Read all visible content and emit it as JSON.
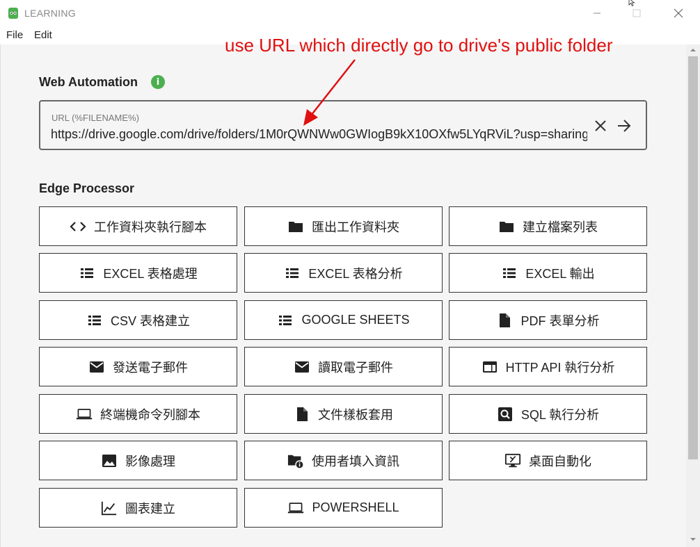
{
  "window": {
    "title": "LEARNING"
  },
  "menu": {
    "file": "File",
    "edit": "Edit"
  },
  "annotation": {
    "text": "use URL which directly go to drive's public folder"
  },
  "web_automation": {
    "title": "Web Automation",
    "url_label": "URL (%FILENAME%)",
    "url_value": "https://drive.google.com/drive/folders/1M0rQWNWw0GWIogB9kX10OXfw5LYqRViL?usp=sharing"
  },
  "edge_processor": {
    "title": "Edge Processor",
    "buttons": [
      {
        "label": "工作資料夾執行腳本",
        "icon": "code-icon"
      },
      {
        "label": "匯出工作資料夾",
        "icon": "folder-icon"
      },
      {
        "label": "建立檔案列表",
        "icon": "folder-icon"
      },
      {
        "label": "EXCEL 表格處理",
        "icon": "list-icon"
      },
      {
        "label": "EXCEL 表格分析",
        "icon": "list-icon"
      },
      {
        "label": "EXCEL 輸出",
        "icon": "list-icon"
      },
      {
        "label": "CSV 表格建立",
        "icon": "list-icon"
      },
      {
        "label": "GOOGLE SHEETS",
        "icon": "list-icon"
      },
      {
        "label": "PDF 表單分析",
        "icon": "file-icon"
      },
      {
        "label": "發送電子郵件",
        "icon": "mail-icon"
      },
      {
        "label": "讀取電子郵件",
        "icon": "mail-icon"
      },
      {
        "label": "HTTP API 執行分析",
        "icon": "web-icon"
      },
      {
        "label": "終端機命令列腳本",
        "icon": "laptop-icon"
      },
      {
        "label": "文件樣板套用",
        "icon": "file-icon"
      },
      {
        "label": "SQL 執行分析",
        "icon": "search-box-icon"
      },
      {
        "label": "影像處理",
        "icon": "image-icon"
      },
      {
        "label": "使用者填入資訊",
        "icon": "folder-info-icon"
      },
      {
        "label": "桌面自動化",
        "icon": "desktop-remote-icon"
      },
      {
        "label": "圖表建立",
        "icon": "chart-line-icon"
      },
      {
        "label": "POWERSHELL",
        "icon": "laptop-icon"
      }
    ]
  },
  "colors": {
    "annotation": "#e01010",
    "info_icon": "#4caf50",
    "content_bg": "#f5f5f5"
  }
}
